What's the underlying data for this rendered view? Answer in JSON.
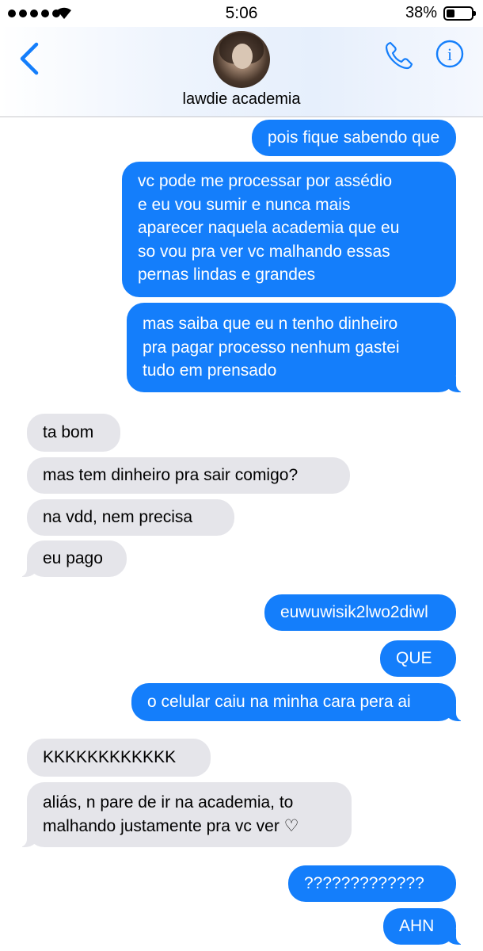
{
  "status_bar": {
    "time": "5:06",
    "battery_percent": "38%",
    "signal_bars": 5,
    "battery_level": 0.38
  },
  "header": {
    "contact_name": "lawdie academia",
    "back_icon": "chevron-left-icon",
    "phone_icon": "phone-icon",
    "info_icon": "info-icon",
    "info_glyph": "i"
  },
  "colors": {
    "accent": "#147efb",
    "sent_bubble": "#147efb",
    "received_bubble": "#e5e5ea"
  },
  "messages": [
    {
      "from": "me",
      "text": "pois fique sabendo que"
    },
    {
      "from": "me",
      "lines": [
        "vc pode me processar por assédio",
        "e eu vou sumir e nunca mais",
        "aparecer naquela academia que eu",
        "so vou pra ver vc malhando essas",
        "pernas lindas e grandes"
      ]
    },
    {
      "from": "me",
      "lines": [
        "mas saiba que eu n tenho dinheiro",
        "pra pagar processo nenhum gastei",
        "tudo em prensado"
      ]
    },
    {
      "from": "them",
      "text": "ta bom"
    },
    {
      "from": "them",
      "text": "mas tem dinheiro pra sair comigo?"
    },
    {
      "from": "them",
      "text": "na vdd, nem precisa"
    },
    {
      "from": "them",
      "text": "eu pago"
    },
    {
      "from": "me",
      "text": "euwuwisik2lwo2diwl"
    },
    {
      "from": "me",
      "text": "QUE"
    },
    {
      "from": "me",
      "text": "o celular caiu na minha cara pera ai"
    },
    {
      "from": "them",
      "text": "KKKKKKKKKKKK"
    },
    {
      "from": "them",
      "lines": [
        "aliás, n pare de ir na academia, to",
        "malhando justamente pra vc ver ♡"
      ]
    },
    {
      "from": "me",
      "text": "?????????????"
    },
    {
      "from": "me",
      "text": "AHN"
    }
  ]
}
